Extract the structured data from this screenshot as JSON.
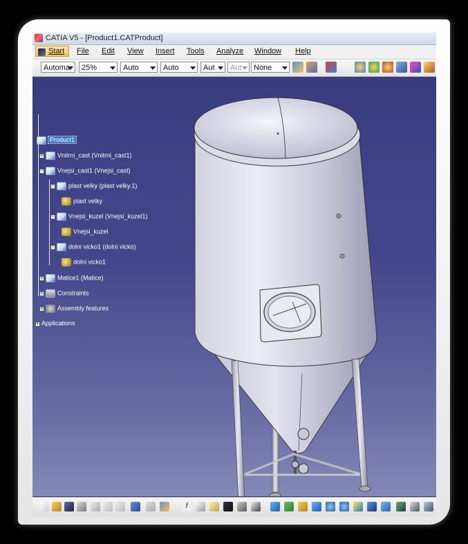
{
  "window": {
    "title": "CATIA V5 - [Product1.CATProduct]"
  },
  "menu": {
    "items": [
      "Start",
      "File",
      "Edit",
      "View",
      "Insert",
      "Tools",
      "Analyze",
      "Window",
      "Help"
    ]
  },
  "toolbar": {
    "combos": [
      "Automa",
      "25%",
      "Auto",
      "Auto",
      "Aut",
      "Aut",
      "None"
    ],
    "colors": {
      "accent": "#3b7bd6",
      "background": "#3a3c80"
    }
  },
  "tree": {
    "root": "Product1",
    "nodes": [
      "Vnitrni_cast (Vnitrni_cast1)",
      "Vnejsi_cast1 (Vnejsi_cast)",
      "plast velky (plast velky.1)",
      "plast velky",
      "Vnejsi_kuzel (Vnejsi_kuzel1)",
      "Vnejsi_kuzel",
      "dolni vicko1 (dolni vicko)",
      "dolni vicko1",
      "Matice1 (Matice)",
      "Constraints",
      "Assembly features",
      "Applications"
    ]
  },
  "icons": [
    "start-icon",
    "product-icon",
    "part-icon",
    "constraints-icon",
    "assembly-features-icon",
    "function-icon"
  ]
}
